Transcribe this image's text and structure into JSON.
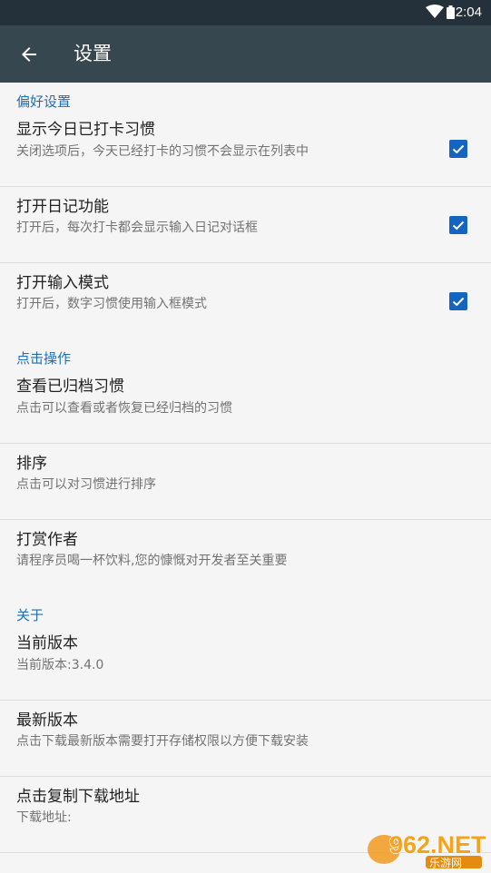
{
  "status_bar": {
    "time": "2:04"
  },
  "toolbar": {
    "title": "设置"
  },
  "sections": {
    "preferences": {
      "header": "偏好设置",
      "items": [
        {
          "title": "显示今日已打卡习惯",
          "subtitle": "关闭选项后，今天已经打卡的习惯不会显示在列表中",
          "checked": true
        },
        {
          "title": "打开日记功能",
          "subtitle": "打开后，每次打卡都会显示输入日记对话框",
          "checked": true
        },
        {
          "title": "打开输入模式",
          "subtitle": "打开后，数字习惯使用输入框模式",
          "checked": true
        }
      ]
    },
    "actions": {
      "header": "点击操作",
      "items": [
        {
          "title": "查看已归档习惯",
          "subtitle": "点击可以查看或者恢复已经归档的习惯"
        },
        {
          "title": "排序",
          "subtitle": "点击可以对习惯进行排序"
        },
        {
          "title": "打赏作者",
          "subtitle": "请程序员喝一杯饮料,您的慷慨对开发者至关重要"
        }
      ]
    },
    "about": {
      "header": "关于",
      "items": [
        {
          "title": "当前版本",
          "subtitle": "当前版本:3.4.0"
        },
        {
          "title": "最新版本",
          "subtitle": "点击下载最新版本需要打开存储权限以方便下载安装"
        },
        {
          "title": "点击复制下载地址",
          "subtitle": "下载地址:"
        }
      ]
    }
  },
  "watermark": {
    "brand": "962.NET",
    "site": "乐游网"
  },
  "colors": {
    "status_bar": "#24313a",
    "toolbar": "#37474f",
    "accent": "#1565c0",
    "section_header": "#1d6fb8",
    "background": "#f5f5f5"
  },
  "icons": {
    "back": "arrow-left-icon",
    "checkbox": "checkbox-checked-icon",
    "wifi": "wifi-icon",
    "battery": "battery-icon"
  }
}
